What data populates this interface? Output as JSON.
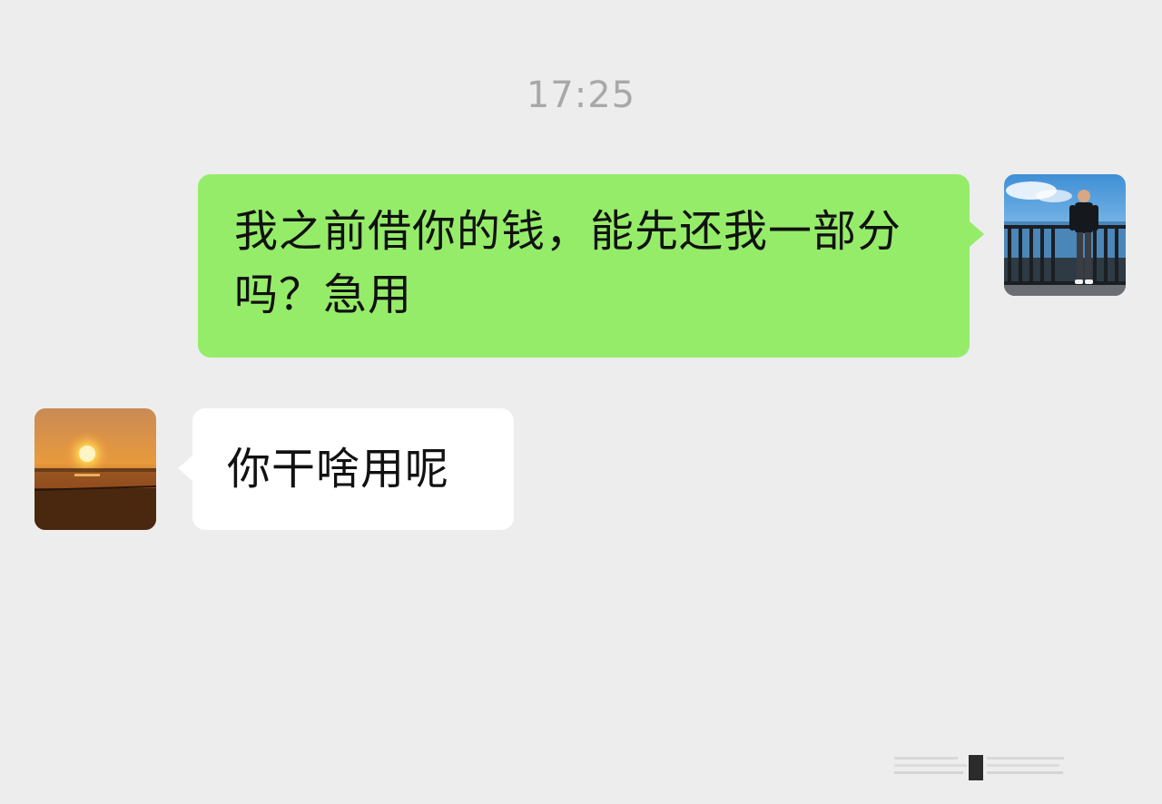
{
  "chat": {
    "timestamp": "17:25",
    "messages": [
      {
        "sender": "self",
        "text": "我之前借你的钱，能先还我一部分吗？急用"
      },
      {
        "sender": "friend",
        "text": "你干啥用呢"
      }
    ]
  },
  "colors": {
    "background": "#ededed",
    "self_bubble": "#95ec69",
    "friend_bubble": "#ffffff",
    "timestamp_text": "#a8a8a8",
    "message_text": "#111111"
  },
  "icons": {
    "self_avatar": "avatar-photo-man-by-sea",
    "friend_avatar": "avatar-photo-sunset"
  }
}
